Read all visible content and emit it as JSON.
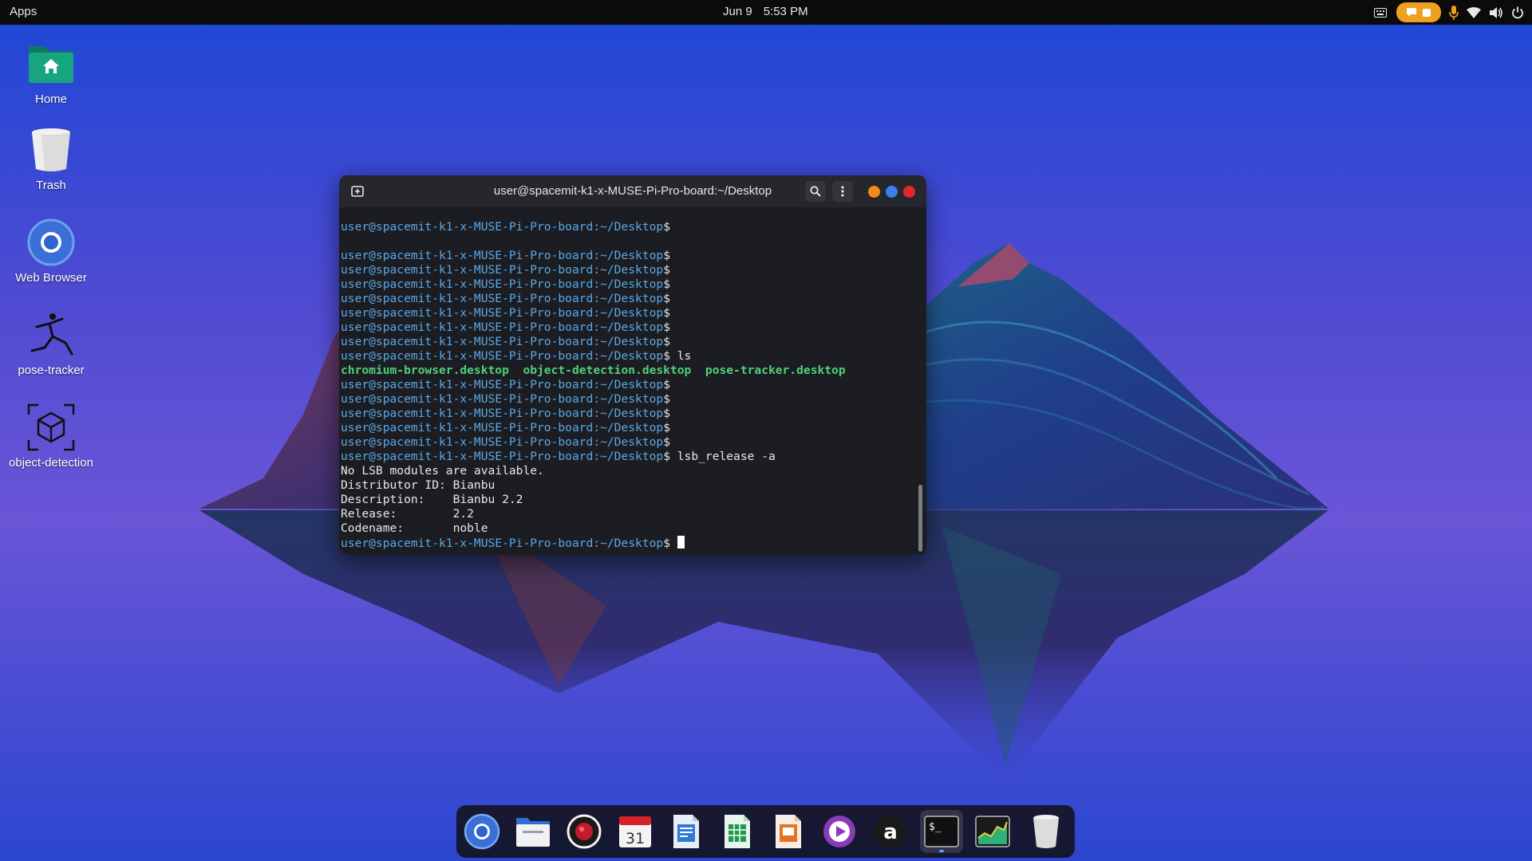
{
  "top_panel": {
    "apps_label": "Apps",
    "date": "Jun 9",
    "time": "5:53 PM",
    "tray_icons": [
      "keyboard-icon",
      "notification-icon",
      "microphone-icon",
      "wifi-icon",
      "volume-icon",
      "power-icon"
    ],
    "accent_color": "#f0a020"
  },
  "desktop_icons": [
    {
      "label": "Home",
      "icon": "home-folder-icon"
    },
    {
      "label": "Trash",
      "icon": "trash-icon"
    },
    {
      "label": "Web Browser",
      "icon": "chromium-icon"
    },
    {
      "label": "pose-tracker",
      "icon": "pose-tracker-icon"
    },
    {
      "label": "object-detection",
      "icon": "object-detection-icon"
    }
  ],
  "terminal": {
    "title": "user@spacemit-k1-x-MUSE-Pi-Pro-board:~/Desktop",
    "prompt_user": "user@spacemit-k1-x-MUSE-Pi-Pro-board",
    "prompt_path": ":~/Desktop",
    "prompt_symbol": "$",
    "lines": [
      {
        "type": "prompt",
        "cmd": ""
      },
      {
        "type": "blank"
      },
      {
        "type": "prompt",
        "cmd": ""
      },
      {
        "type": "prompt",
        "cmd": ""
      },
      {
        "type": "prompt",
        "cmd": ""
      },
      {
        "type": "prompt",
        "cmd": ""
      },
      {
        "type": "prompt",
        "cmd": ""
      },
      {
        "type": "prompt",
        "cmd": ""
      },
      {
        "type": "prompt",
        "cmd": ""
      },
      {
        "type": "prompt",
        "cmd": " ls"
      },
      {
        "type": "files",
        "items": [
          "chromium-browser.desktop",
          "object-detection.desktop",
          "pose-tracker.desktop"
        ]
      },
      {
        "type": "prompt",
        "cmd": ""
      },
      {
        "type": "prompt",
        "cmd": ""
      },
      {
        "type": "prompt",
        "cmd": ""
      },
      {
        "type": "prompt",
        "cmd": ""
      },
      {
        "type": "prompt",
        "cmd": ""
      },
      {
        "type": "prompt",
        "cmd": " lsb_release -a"
      },
      {
        "type": "output",
        "text": "No LSB modules are available."
      },
      {
        "type": "output",
        "text": "Distributor ID: Bianbu"
      },
      {
        "type": "output",
        "text": "Description:    Bianbu 2.2"
      },
      {
        "type": "output",
        "text": "Release:        2.2"
      },
      {
        "type": "output",
        "text": "Codename:       noble"
      },
      {
        "type": "prompt",
        "cmd": " ",
        "cursor": true
      }
    ],
    "colors": {
      "prompt": "#5aa7e6",
      "files": "#4fd07a"
    }
  },
  "dock": {
    "items": [
      {
        "name": "dock-chromium",
        "icon": "chromium-icon"
      },
      {
        "name": "dock-files",
        "icon": "folder-icon"
      },
      {
        "name": "dock-recorder",
        "icon": "record-icon"
      },
      {
        "name": "dock-calendar",
        "icon": "calendar-icon",
        "text": "31"
      },
      {
        "name": "dock-writer",
        "icon": "document-icon"
      },
      {
        "name": "dock-calc",
        "icon": "spreadsheet-icon"
      },
      {
        "name": "dock-impress",
        "icon": "presentation-icon"
      },
      {
        "name": "dock-media-player",
        "icon": "play-icon"
      },
      {
        "name": "dock-app-store",
        "icon": "app-store-icon",
        "text": "a"
      },
      {
        "name": "dock-terminal",
        "icon": "terminal-icon",
        "text": "$_",
        "active": true
      },
      {
        "name": "dock-system-monitor",
        "icon": "system-monitor-icon"
      },
      {
        "name": "dock-trash",
        "icon": "trash-icon"
      }
    ]
  }
}
